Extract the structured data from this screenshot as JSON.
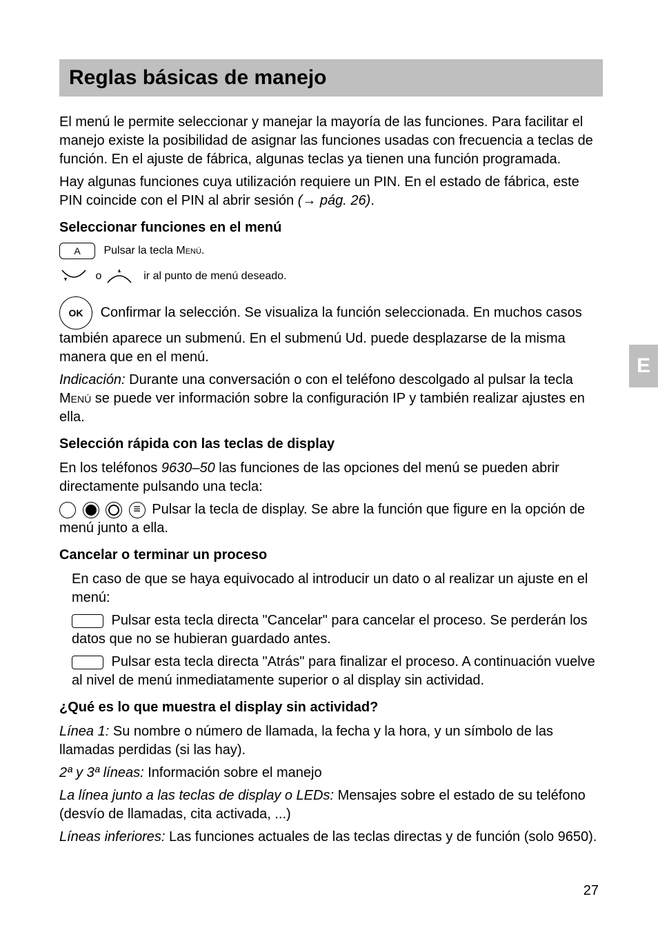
{
  "page": {
    "number": "27",
    "side_tab": "E"
  },
  "title": "Reglas básicas de manejo",
  "intro1": "El menú le permite seleccionar y manejar la mayoría de las funciones. Para facilitar el manejo existe la posibilidad de asignar las funciones usadas con frecuencia a teclas de función. En el ajuste de fábrica, algunas teclas ya tienen una función programada.",
  "intro2a": "Hay algunas funciones cuya utilización requiere un PIN. En el estado de fábrica, este PIN coincide con el PIN al abrir sesión ",
  "intro2b_italic": "(→ pág. 26)",
  "intro2c": ".",
  "sec_select": {
    "head": "Seleccionar funciones en el menú",
    "key_a_label": "A",
    "step1a": " Pulsar la tecla M",
    "step1b_sc": "enú",
    "step1c": ".",
    "step2_o": " o ",
    "step2_rest": " ir al punto de menú deseado.",
    "ok_label": "OK",
    "step3": " Confirmar la selección. Se visualiza la función seleccionada. En muchos casos también aparece un submenú. En el submenú Ud. puede desplazarse de la misma manera que en el menú.",
    "note_label": "Indicación:",
    "note_a": " Durante una conversación o con el teléfono descolgado al pulsar la tecla M",
    "note_b_sc": "enú",
    "note_c": " se puede ver información sobre la configuración IP y también realizar ajustes en ella."
  },
  "sec_quick": {
    "head": "Selección rápida con las teclas de display",
    "p1a": "En los teléfonos ",
    "p1b_italic": "9630–50",
    "p1c": " las funciones de las opciones del menú se pueden abrir directamente pulsando una tecla:",
    "p2": " Pulsar la tecla de display. Se abre la función que figure en la opción de menú junto a ella."
  },
  "sec_cancel": {
    "head": "Cancelar o terminar un proceso",
    "p1": "En caso de que se haya equivocado al introducir un dato o al realizar un ajuste en el menú:",
    "p2": " Pulsar esta tecla directa \"Cancelar\" para cancelar el proceso. Se perderán los datos que no se hubieran guardado antes.",
    "p3": " Pulsar esta tecla directa \"Atrás\" para finalizar el proceso. A continuación vuelve al nivel de menú inmediatamente superior o al display sin actividad."
  },
  "sec_idle": {
    "head": "¿Qué es lo que muestra el display sin actividad?",
    "l1_label": "Línea 1:",
    "l1_text": " Su nombre o número de llamada, la fecha y la hora, y un símbolo de las llamadas perdidas (si las hay).",
    "l23_label": "2ª y 3ª  líneas:",
    "l23_text": " Información sobre el manejo",
    "lleds_label": "La línea junto a las teclas de display o LEDs:",
    "lleds_text": " Mensajes sobre el estado de su teléfono (desvío de llamadas, cita activada, ...)",
    "linf_label": "Líneas inferiores:",
    "linf_text": " Las funciones actuales de las teclas directas y de función (solo 9650)."
  }
}
